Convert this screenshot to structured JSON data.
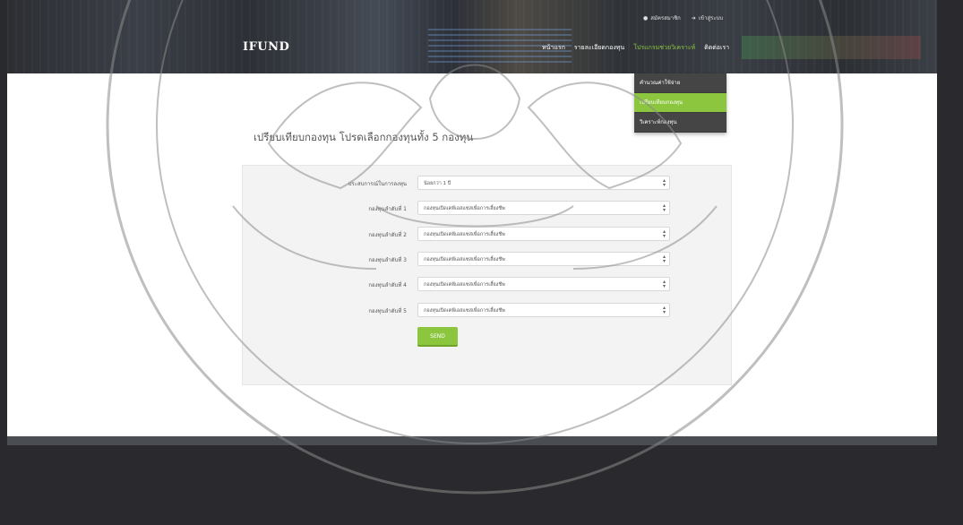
{
  "header": {
    "brand": "IFUND",
    "top_links": [
      {
        "icon": "user-icon",
        "label": "สมัครสมาชิก"
      },
      {
        "icon": "login-icon",
        "label": "เข้าสู่ระบบ"
      }
    ],
    "nav": [
      {
        "label": "หน้าแรก",
        "active": false
      },
      {
        "label": "รายละเอียดกองทุน",
        "active": false
      },
      {
        "label": "โปรแกรมช่วยวิเคราะห์",
        "active": true
      },
      {
        "label": "ติดต่อเรา",
        "active": false
      }
    ]
  },
  "dropdown": [
    {
      "label": "คำนวณค่าใช้จ่าย",
      "selected": false
    },
    {
      "label": "เปรียบเทียบกองทุน",
      "selected": true
    },
    {
      "label": "วิเคราะห์กองทุน",
      "selected": false
    }
  ],
  "page_title": "เปรียบเทียบกองทุน โปรดเลือกกองทุนทั้ง 5 กองทุน",
  "form": {
    "rows": [
      {
        "label": "ประสบการณ์ในการลงทุน",
        "value": "น้อยกว่า 1 ปี"
      },
      {
        "label": "กองทุนลำดับที่ 1",
        "value": "กองทุนเปิดเคพีเอสแซสเพื่อการเลี้ยงชีพ"
      },
      {
        "label": "กองทุนลำดับที่ 2",
        "value": "กองทุนเปิดเคพีเอสแซสเพื่อการเลี้ยงชีพ"
      },
      {
        "label": "กองทุนลำดับที่ 3",
        "value": "กองทุนเปิดเคพีเอสแซสเพื่อการเลี้ยงชีพ"
      },
      {
        "label": "กองทุนลำดับที่ 4",
        "value": "กองทุนเปิดเคพีเอสแซสเพื่อการเลี้ยงชีพ"
      },
      {
        "label": "กองทุนลำดับที่ 5",
        "value": "กองทุนเปิดเคพีเอสแซสเพื่อการเลี้ยงชีพ"
      }
    ],
    "submit_label": "SEND"
  },
  "colors": {
    "accent": "#8cc63f",
    "header": "#2f3238",
    "footer": "#2a2a2e"
  }
}
